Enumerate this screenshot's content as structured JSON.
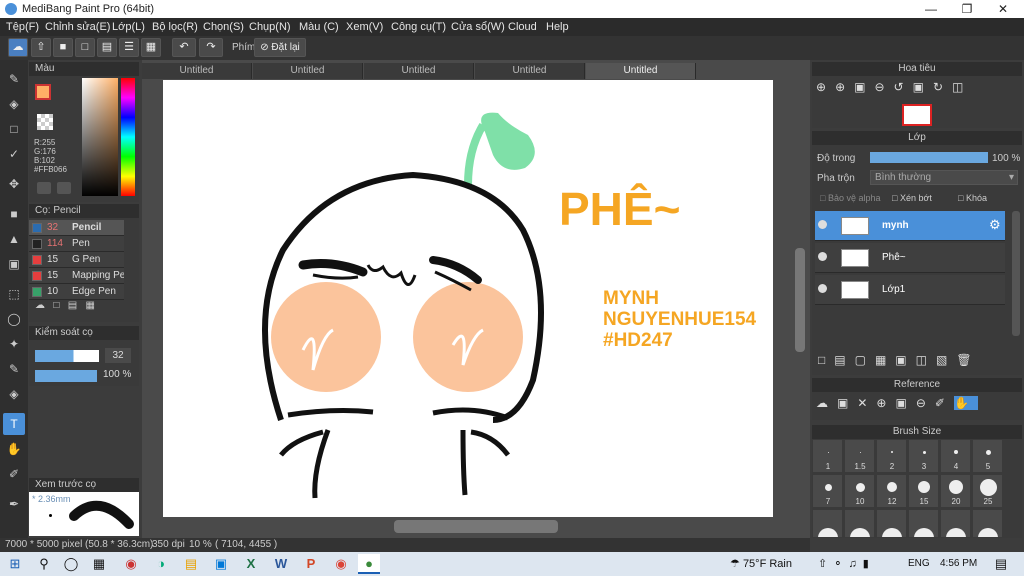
{
  "app": {
    "title": "MediBang Paint Pro (64bit)"
  },
  "menu": [
    "Tệp(F)",
    "Chỉnh sửa(E)",
    "Lớp(L)",
    "Bộ lọc(R)",
    "Chọn(S)",
    "Chụp(N)",
    "Màu (C)",
    "Xem(V)",
    "Công cụ(T)",
    "Cửa sổ(W)",
    "Cloud",
    "Help"
  ],
  "toolbar": {
    "key_label": "Phím",
    "reset_label": "Đặt lại"
  },
  "color_panel": {
    "title": "Màu",
    "r": "R:255",
    "g": "G:176",
    "b": "B:102",
    "hex": "#FFB066",
    "fg": "#ffb066"
  },
  "brush_panel": {
    "title": "Cọ: Pencil",
    "items": [
      {
        "size": "32",
        "name": "Pencil",
        "color": "#2b6cb0"
      },
      {
        "size": "114",
        "name": "Pen",
        "color": "#222"
      },
      {
        "size": "15",
        "name": "G Pen",
        "color": "#e53e3e"
      },
      {
        "size": "15",
        "name": "Mapping Pe",
        "color": "#e53e3e"
      },
      {
        "size": "10",
        "name": "Edge Pen",
        "color": "#38a169"
      }
    ]
  },
  "brush_control": {
    "title": "Kiểm soát cọ",
    "size": "32",
    "opacity": "100 %"
  },
  "preview": {
    "title": "Xem trước cọ",
    "size": "2.36mm"
  },
  "tabs": [
    "Untitled",
    "Untitled",
    "Untitled",
    "Untitled",
    "Untitled"
  ],
  "artwork": {
    "phe": "PHÊ~",
    "line1": "MYNH",
    "line2": "NGUYENHUE154",
    "line3": "#HD247"
  },
  "navigator": {
    "title": "Hoa tiêu"
  },
  "layers_panel": {
    "title": "Lớp",
    "opacity_label": "Độ trong",
    "opacity_value": "100 %",
    "blend_label": "Pha trộn",
    "blend_value": "Bình thường",
    "protect_alpha": "Bảo vệ alpha",
    "clip": "Xén bớt",
    "lock": "Khóa",
    "layers": [
      {
        "name": "mynh",
        "selected": true
      },
      {
        "name": "Phê~",
        "selected": false
      },
      {
        "name": "Lớp1",
        "selected": false
      }
    ]
  },
  "reference": {
    "title": "Reference"
  },
  "brush_size": {
    "title": "Brush Size",
    "row1": [
      "1",
      "1.5",
      "2",
      "3",
      "4",
      "5"
    ],
    "row2": [
      "7",
      "10",
      "12",
      "15",
      "20",
      "25"
    ]
  },
  "status": {
    "size": "7000 * 5000 pixel",
    "mm": "(50.8 * 36.3cm)",
    "dpi": "350 dpi",
    "zoom": "10 %",
    "coords": "( 7104, 4455 )"
  },
  "taskbar": {
    "weather_temp": "75°F",
    "weather_text": "Rain",
    "lang": "ENG",
    "time": "4:56 PM"
  }
}
